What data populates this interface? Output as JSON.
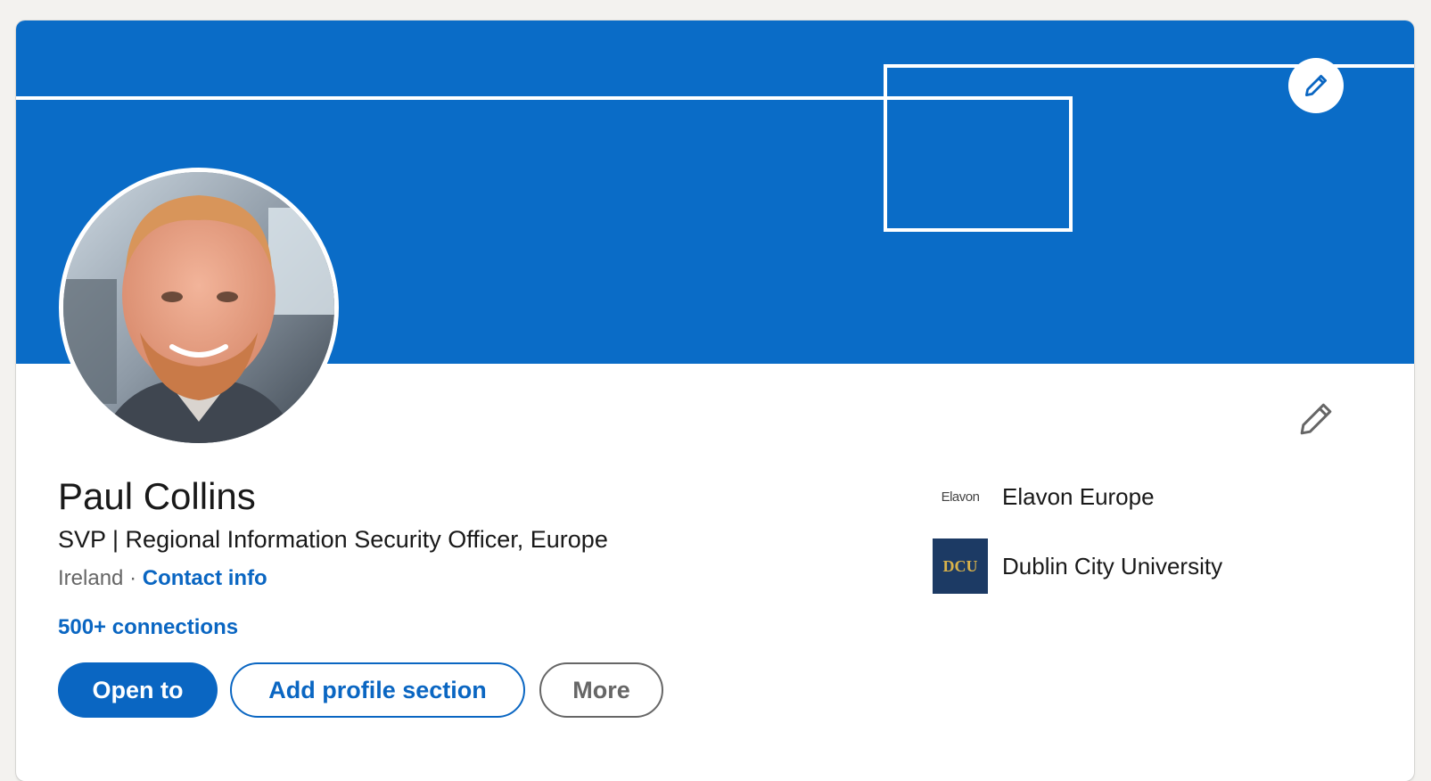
{
  "profile": {
    "name": "Paul Collins",
    "headline": "SVP | Regional Information Security Officer, Europe",
    "location": "Ireland",
    "separator": "·",
    "contact_info_label": "Contact info",
    "connections_label": "500+ connections"
  },
  "actions": {
    "open_to_label": "Open to",
    "add_section_label": "Add profile section",
    "more_label": "More"
  },
  "organizations": [
    {
      "name": "Elavon Europe",
      "logo_text": "Elavon",
      "icon": "elavon-logo"
    },
    {
      "name": "Dublin City University",
      "logo_text": "DCU",
      "icon": "dcu-logo"
    }
  ],
  "icons": {
    "banner_edit": "pencil-icon",
    "intro_edit": "pencil-icon"
  },
  "colors": {
    "banner": "#0a6cc7",
    "accent": "#0a66c2",
    "text_primary": "#191919",
    "text_secondary": "#666666",
    "page_bg": "#f3f2ef"
  }
}
